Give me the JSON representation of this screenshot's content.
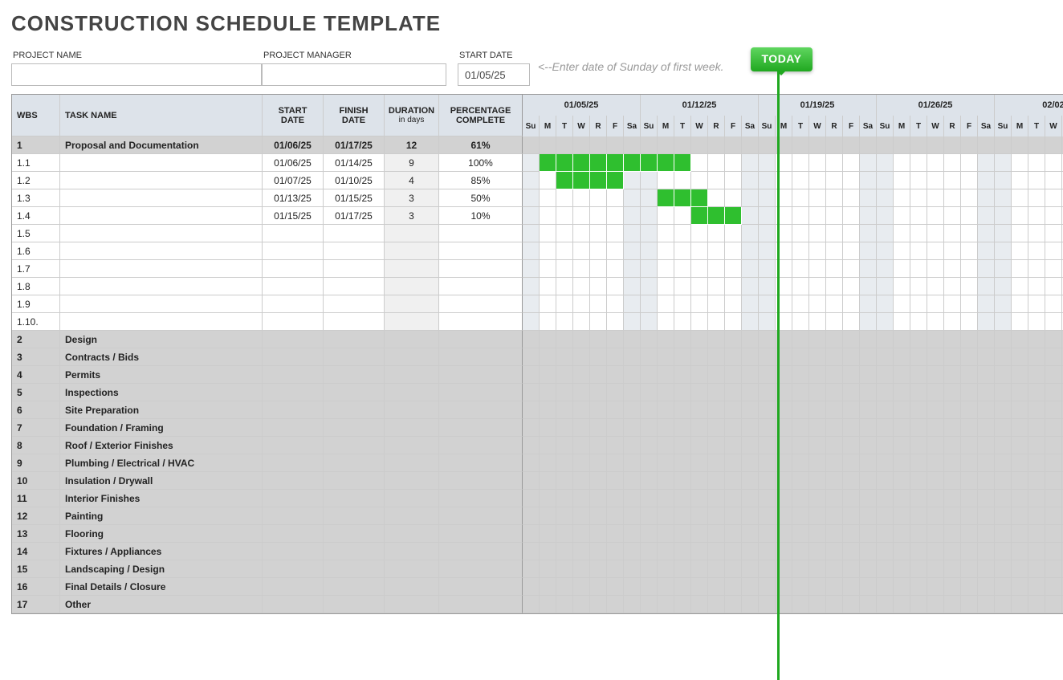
{
  "title": "CONSTRUCTION SCHEDULE TEMPLATE",
  "meta": {
    "project_name_label": "PROJECT NAME",
    "project_name_value": "",
    "project_manager_label": "PROJECT MANAGER",
    "project_manager_value": "",
    "start_date_label": "START DATE",
    "start_date_value": "01/05/25",
    "hint": "<--Enter date of Sunday of first week.",
    "today_label": "TODAY"
  },
  "columns": {
    "wbs": "WBS",
    "task": "TASK NAME",
    "start": "START DATE",
    "finish": "FINISH DATE",
    "duration": "DURATION",
    "duration_sub": "in days",
    "pct": "PERCENTAGE COMPLETE"
  },
  "weeks": [
    "01/05/25",
    "01/12/25",
    "01/19/25",
    "01/26/25",
    "02/02"
  ],
  "day_headers": [
    "Su",
    "M",
    "T",
    "W",
    "R",
    "F",
    "Sa"
  ],
  "today_day_index": 14,
  "rows": [
    {
      "type": "phase",
      "wbs": "1",
      "task": "Proposal and Documentation",
      "start": "01/06/25",
      "finish": "01/17/25",
      "dur": "12",
      "pct": "61%",
      "bar_start": null,
      "bar_len": 0
    },
    {
      "type": "task",
      "wbs": "1.1",
      "task": "",
      "start": "01/06/25",
      "finish": "01/14/25",
      "dur": "9",
      "pct": "100%",
      "bar_start": 1,
      "bar_len": 9
    },
    {
      "type": "task",
      "wbs": "1.2",
      "task": "",
      "start": "01/07/25",
      "finish": "01/10/25",
      "dur": "4",
      "pct": "85%",
      "bar_start": 2,
      "bar_len": 4
    },
    {
      "type": "task",
      "wbs": "1.3",
      "task": "",
      "start": "01/13/25",
      "finish": "01/15/25",
      "dur": "3",
      "pct": "50%",
      "bar_start": 8,
      "bar_len": 3
    },
    {
      "type": "task",
      "wbs": "1.4",
      "task": "",
      "start": "01/15/25",
      "finish": "01/17/25",
      "dur": "3",
      "pct": "10%",
      "bar_start": 10,
      "bar_len": 3
    },
    {
      "type": "task",
      "wbs": "1.5",
      "task": "",
      "start": "",
      "finish": "",
      "dur": "",
      "pct": "",
      "bar_start": null,
      "bar_len": 0
    },
    {
      "type": "task",
      "wbs": "1.6",
      "task": "",
      "start": "",
      "finish": "",
      "dur": "",
      "pct": "",
      "bar_start": null,
      "bar_len": 0
    },
    {
      "type": "task",
      "wbs": "1.7",
      "task": "",
      "start": "",
      "finish": "",
      "dur": "",
      "pct": "",
      "bar_start": null,
      "bar_len": 0
    },
    {
      "type": "task",
      "wbs": "1.8",
      "task": "",
      "start": "",
      "finish": "",
      "dur": "",
      "pct": "",
      "bar_start": null,
      "bar_len": 0
    },
    {
      "type": "task",
      "wbs": "1.9",
      "task": "",
      "start": "",
      "finish": "",
      "dur": "",
      "pct": "",
      "bar_start": null,
      "bar_len": 0
    },
    {
      "type": "task",
      "wbs": "1.10.",
      "task": "",
      "start": "",
      "finish": "",
      "dur": "",
      "pct": "",
      "bar_start": null,
      "bar_len": 0
    },
    {
      "type": "phase",
      "wbs": "2",
      "task": "Design",
      "start": "",
      "finish": "",
      "dur": "",
      "pct": "",
      "bar_start": null,
      "bar_len": 0
    },
    {
      "type": "phase",
      "wbs": "3",
      "task": "Contracts / Bids",
      "start": "",
      "finish": "",
      "dur": "",
      "pct": "",
      "bar_start": null,
      "bar_len": 0
    },
    {
      "type": "phase",
      "wbs": "4",
      "task": "Permits",
      "start": "",
      "finish": "",
      "dur": "",
      "pct": "",
      "bar_start": null,
      "bar_len": 0
    },
    {
      "type": "phase",
      "wbs": "5",
      "task": "Inspections",
      "start": "",
      "finish": "",
      "dur": "",
      "pct": "",
      "bar_start": null,
      "bar_len": 0
    },
    {
      "type": "phase",
      "wbs": "6",
      "task": "Site Preparation",
      "start": "",
      "finish": "",
      "dur": "",
      "pct": "",
      "bar_start": null,
      "bar_len": 0
    },
    {
      "type": "phase",
      "wbs": "7",
      "task": "Foundation / Framing",
      "start": "",
      "finish": "",
      "dur": "",
      "pct": "",
      "bar_start": null,
      "bar_len": 0
    },
    {
      "type": "phase",
      "wbs": "8",
      "task": "Roof / Exterior Finishes",
      "start": "",
      "finish": "",
      "dur": "",
      "pct": "",
      "bar_start": null,
      "bar_len": 0
    },
    {
      "type": "phase",
      "wbs": "9",
      "task": "Plumbing / Electrical / HVAC",
      "start": "",
      "finish": "",
      "dur": "",
      "pct": "",
      "bar_start": null,
      "bar_len": 0
    },
    {
      "type": "phase",
      "wbs": "10",
      "task": "Insulation / Drywall",
      "start": "",
      "finish": "",
      "dur": "",
      "pct": "",
      "bar_start": null,
      "bar_len": 0
    },
    {
      "type": "phase",
      "wbs": "11",
      "task": "Interior Finishes",
      "start": "",
      "finish": "",
      "dur": "",
      "pct": "",
      "bar_start": null,
      "bar_len": 0
    },
    {
      "type": "phase",
      "wbs": "12",
      "task": "Painting",
      "start": "",
      "finish": "",
      "dur": "",
      "pct": "",
      "bar_start": null,
      "bar_len": 0
    },
    {
      "type": "phase",
      "wbs": "13",
      "task": "Flooring",
      "start": "",
      "finish": "",
      "dur": "",
      "pct": "",
      "bar_start": null,
      "bar_len": 0
    },
    {
      "type": "phase",
      "wbs": "14",
      "task": "Fixtures / Appliances",
      "start": "",
      "finish": "",
      "dur": "",
      "pct": "",
      "bar_start": null,
      "bar_len": 0
    },
    {
      "type": "phase",
      "wbs": "15",
      "task": "Landscaping / Design",
      "start": "",
      "finish": "",
      "dur": "",
      "pct": "",
      "bar_start": null,
      "bar_len": 0
    },
    {
      "type": "phase",
      "wbs": "16",
      "task": "Final Details / Closure",
      "start": "",
      "finish": "",
      "dur": "",
      "pct": "",
      "bar_start": null,
      "bar_len": 0
    },
    {
      "type": "phase",
      "wbs": "17",
      "task": "Other",
      "start": "",
      "finish": "",
      "dur": "",
      "pct": "",
      "bar_start": null,
      "bar_len": 0
    }
  ]
}
